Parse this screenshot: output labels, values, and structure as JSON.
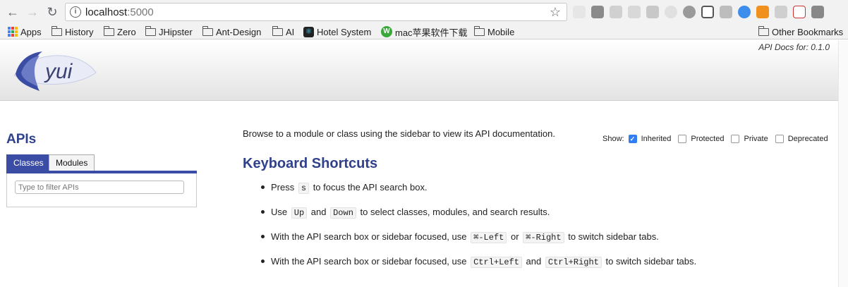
{
  "browser": {
    "url_host": "localhost",
    "url_port": ":5000",
    "bookmarks": [
      "Apps",
      "History",
      "Zero",
      "JHipster",
      "Ant-Design",
      "AI",
      "Hotel System",
      "mac苹果软件下载",
      "Mobile",
      "Other Bookmarks"
    ]
  },
  "header": {
    "logo_text": "yui",
    "version": "API Docs for: 0.1.0"
  },
  "sidebar": {
    "title": "APIs",
    "tabs": [
      "Classes",
      "Modules"
    ],
    "filter_placeholder": "Type to filter APIs"
  },
  "main": {
    "intro": "Browse to a module or class using the sidebar to view its API documentation.",
    "show_label": "Show:",
    "options": [
      {
        "label": "Inherited",
        "checked": true
      },
      {
        "label": "Protected",
        "checked": false
      },
      {
        "label": "Private",
        "checked": false
      },
      {
        "label": "Deprecated",
        "checked": false
      }
    ],
    "shortcuts_title": "Keyboard Shortcuts",
    "shortcuts": [
      {
        "t1": "Press",
        "k1": "s",
        "t2": "to focus the API search box."
      },
      {
        "t1": "Use",
        "k1": "Up",
        "t2": "and",
        "k2": "Down",
        "t3": "to select classes, modules, and search results."
      },
      {
        "t1": "With the API search box or sidebar focused, use",
        "k1": "⌘-Left",
        "t2": "or",
        "k2": "⌘-Right",
        "t3": "to switch sidebar tabs."
      },
      {
        "t1": "With the API search box or sidebar focused, use",
        "k1": "Ctrl+Left",
        "t2": "and",
        "k2": "Ctrl+Right",
        "t3": "to switch sidebar tabs."
      }
    ]
  },
  "colors": {
    "heading": "#30418c",
    "tab_active": "#3a4ca4",
    "checkbox_checked": "#2f7ef5"
  }
}
